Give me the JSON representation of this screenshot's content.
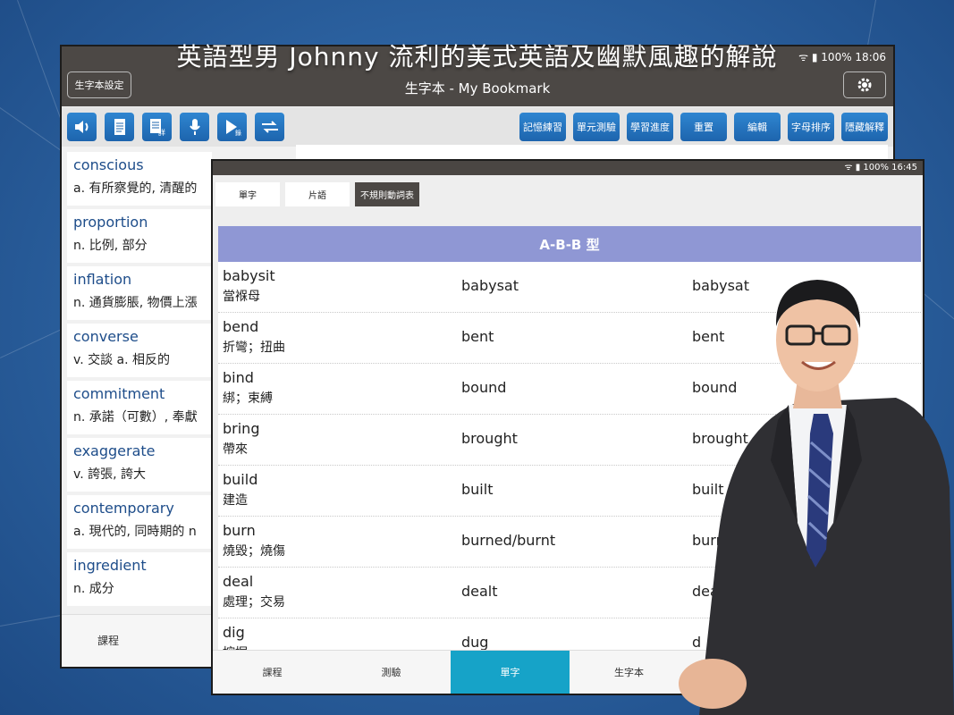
{
  "headline": "英語型男 Johnny 流利的美式英語及幽默風趣的解說",
  "back_tablet": {
    "status": "100% 18:06",
    "settings_button": "生字本設定",
    "title": "生字本 - My Bookmark",
    "toolbar_icons": [
      "speaker-icon",
      "document-icon",
      "detail-document-icon",
      "microphone-icon",
      "play-record-icon",
      "swap-icon"
    ],
    "toolbar_buttons": [
      "記憶練習",
      "單元測驗",
      "學習進度",
      "重置",
      "編輯",
      "字母排序",
      "隱藏解釋"
    ],
    "words": [
      {
        "word": "conscious",
        "def": "a. 有所察覺的, 清醒的"
      },
      {
        "word": "proportion",
        "def": "n. 比例, 部分"
      },
      {
        "word": "inflation",
        "def": "n. 通貨膨脹, 物價上漲"
      },
      {
        "word": "converse",
        "def": "v. 交談  a. 相反的"
      },
      {
        "word": "commitment",
        "def": "n. 承諾（可數）, 奉獻"
      },
      {
        "word": "exaggerate",
        "def": "v. 誇張, 誇大"
      },
      {
        "word": "contemporary",
        "def": "a. 現代的, 同時期的 n"
      },
      {
        "word": "ingredient",
        "def": "n. 成分"
      }
    ],
    "bottom_tab": "課程"
  },
  "front_tablet": {
    "status": "100% 16:45",
    "tabs": [
      "單字",
      "片語",
      "不規則動詞表"
    ],
    "active_tab": 2,
    "table_header": "A-B-B 型",
    "rows": [
      {
        "base": "babysit",
        "zh": "當褓母",
        "past": "babysat",
        "pp": "babysat"
      },
      {
        "base": "bend",
        "zh": "折彎；扭曲",
        "past": "bent",
        "pp": "bent"
      },
      {
        "base": "bind",
        "zh": "綁；束縛",
        "past": "bound",
        "pp": "bound"
      },
      {
        "base": "bring",
        "zh": "帶來",
        "past": "brought",
        "pp": "brought"
      },
      {
        "base": "build",
        "zh": "建造",
        "past": "built",
        "pp": "built"
      },
      {
        "base": "burn",
        "zh": "燒毀；燒傷",
        "past": "burned/burnt",
        "pp": "burned"
      },
      {
        "base": "deal",
        "zh": "處理；交易",
        "past": "dealt",
        "pp": "dea"
      },
      {
        "base": "dig",
        "zh": "挖掘",
        "past": "dug",
        "pp": "d"
      }
    ],
    "bottom_nav": [
      "課程",
      "測驗",
      "單字",
      "生字本"
    ],
    "active_nav": 2
  },
  "colors": {
    "accent_blue": "#2f86d1",
    "header_purple": "#8f97d4",
    "nav_active": "#16a3c8",
    "dark_bar": "#4c4845"
  }
}
